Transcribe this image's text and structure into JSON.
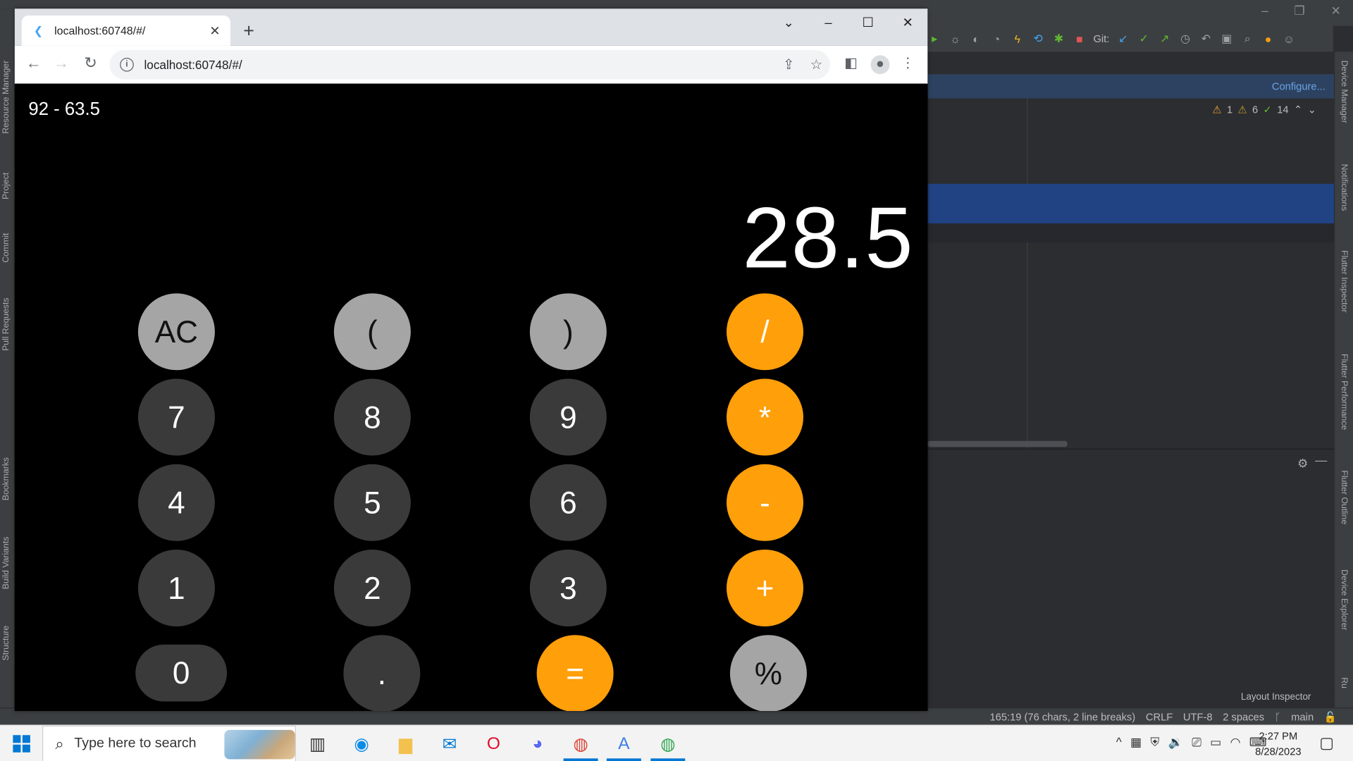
{
  "ide": {
    "toolbar_git_label": "Git:",
    "banner_link": "Configure...",
    "inspections": {
      "errors": "1",
      "warnings": "6",
      "checks": "14"
    },
    "left_tabs": [
      "Resource Manager",
      "Project",
      "Commit",
      "Pull Requests",
      "Bookmarks",
      "Build Variants",
      "Structure"
    ],
    "right_tabs": [
      "Device Manager",
      "Notifications",
      "Flutter Inspector",
      "Flutter Performance",
      "Flutter Outline",
      "Device Explorer",
      "Ru"
    ],
    "layout_inspector": "Layout Inspector",
    "status": {
      "position": "165:19 (76 chars, 2 line breaks)",
      "line_sep": "CRLF",
      "encoding": "UTF-8",
      "indent": "2 spaces",
      "branch": "main"
    }
  },
  "browser": {
    "tab_title": "localhost:60748/#/",
    "url": "localhost:60748/#/"
  },
  "calculator": {
    "expression": "92 - 63.5",
    "result": "28.5",
    "buttons": {
      "ac": "AC",
      "open_paren": "(",
      "close_paren": ")",
      "divide": "/",
      "seven": "7",
      "eight": "8",
      "nine": "9",
      "multiply": "*",
      "four": "4",
      "five": "5",
      "six": "6",
      "minus": "-",
      "one": "1",
      "two": "2",
      "three": "3",
      "plus": "+",
      "zero": "0",
      "dot": ".",
      "equals": "=",
      "percent": "%"
    },
    "colors": {
      "function": "#a5a5a5",
      "digit": "#3a3a3a",
      "operator": "#ff9f0a"
    }
  },
  "taskbar": {
    "search_placeholder": "Type here to search",
    "time": "2:27 PM",
    "date": "8/28/2023"
  }
}
